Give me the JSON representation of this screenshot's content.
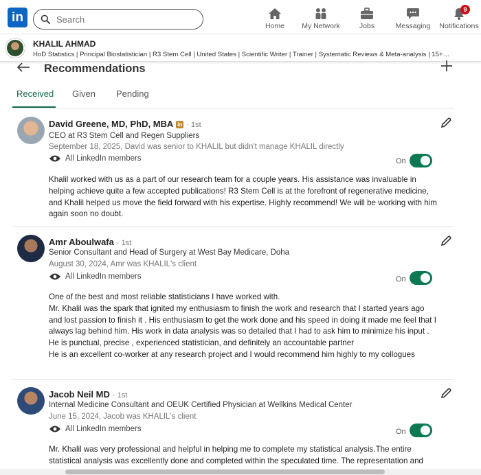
{
  "topnav": {
    "logo_text": "in",
    "search_placeholder": "Search",
    "items": [
      {
        "label": "Home",
        "icon": "home-icon"
      },
      {
        "label": "My Network",
        "icon": "network-icon"
      },
      {
        "label": "Jobs",
        "icon": "briefcase-icon"
      },
      {
        "label": "Messaging",
        "icon": "messaging-icon"
      },
      {
        "label": "Notifications",
        "icon": "bell-icon",
        "badge": "9"
      }
    ]
  },
  "profile": {
    "name": "KHALIL AHMAD",
    "headline": "HoD Statistics | Principal Biostatistician | R3 Stem Cell | United States | Scientific Writer | Trainer | Systematic Reviews & Meta-analysis | 15+…"
  },
  "page": {
    "title": "Recommendations",
    "tabs": [
      "Received",
      "Given",
      "Pending"
    ],
    "active_tab": "Received"
  },
  "recommendations": [
    {
      "name": "David Greene, MD, PhD, MBA",
      "degree": "· 1st",
      "title": "CEO at R3 Stem Cell and Regen Suppliers",
      "date": "September 18, 2025, David was senior to KHALIL but didn't manage KHALIL directly",
      "visibility": "All LinkedIn members",
      "toggle_label": "On",
      "paragraphs": [
        "Khalil worked with us as a part of our research team for a couple years. His assistance was invaluable in helping achieve quite a few accepted publications! R3 Stem Cell is at the forefront of regenerative medicine, and Khalil helped us move the field forward with his expertise. Highly recommend! We will be working with him again soon no doubt."
      ]
    },
    {
      "name": "Amr Aboulwafa",
      "degree": "· 1st",
      "title": "Senior Consultant and Head of Surgery at West Bay Medicare, Doha",
      "date": "August 30, 2024, Amr was KHALIL's client",
      "visibility": "All LinkedIn members",
      "toggle_label": "On",
      "paragraphs": [
        "One of the best and most reliable statisticians I have worked with.",
        "Mr. Khalil was the spark that ignited my enthusiasm to finish the work and research that I started years ago and lost passion to finish it . His enthusiasm to get the work done and his speed in doing it made me feel that I always lag behind him. His work in data analysis was so detailed that I had to ask him to minimize his input .",
        "He is punctual, precise , experienced statistician, and definitely an accountable partner",
        "He is an excellent co-worker at any research project and I would recommend him highly to my collogues"
      ]
    },
    {
      "name": "Jacob Neil MD",
      "degree": "· 1st",
      "title": "Internal Medicine Consultant and OEUK Certified Physician at Wellkins Medical Center",
      "date": "June 15, 2024, Jacob was KHALIL's client",
      "visibility": "All LinkedIn members",
      "toggle_label": "On",
      "paragraphs": [
        "Mr. Khalil was very professional and helpful in helping me to complete my statistical analysis.The entire statistical analysis was excellently done and completed within the speculated time. The representation and"
      ]
    }
  ],
  "colors": {
    "brand": "#0a66c2",
    "accent_green": "#0b7a52",
    "notification_badge": "#cc1016"
  }
}
